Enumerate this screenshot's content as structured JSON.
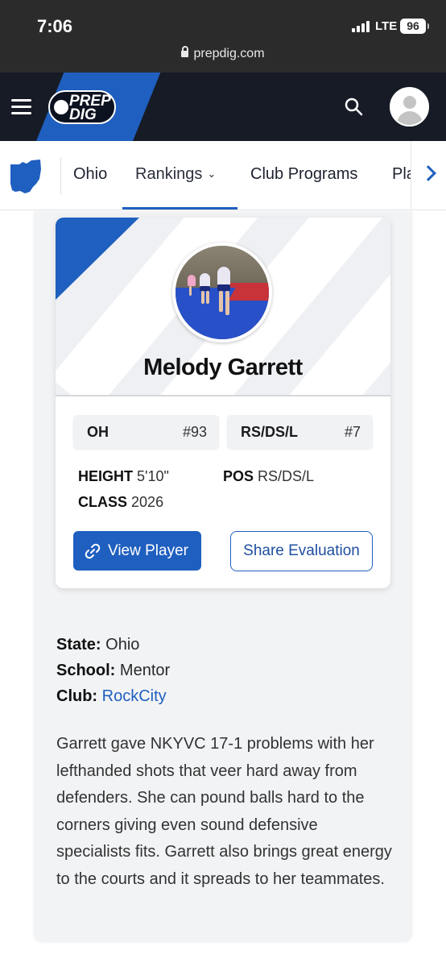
{
  "status_bar": {
    "time": "7:06",
    "network": "LTE",
    "battery": "96"
  },
  "browser": {
    "url": "prepdig.com"
  },
  "header": {
    "logo_line1": "PREP",
    "logo_line2": "DIG"
  },
  "nav": {
    "state": "Ohio",
    "items": [
      {
        "label": "Ohio"
      },
      {
        "label": "Rankings"
      },
      {
        "label": "Club Programs"
      },
      {
        "label": "Pla"
      }
    ],
    "active_color": "#1f5fbf"
  },
  "player": {
    "name": "Melody Garrett",
    "positions": [
      {
        "label": "OH",
        "rank": "#93"
      },
      {
        "label": "RS/DS/L",
        "rank": "#7"
      }
    ],
    "height_label": "HEIGHT",
    "height": "5'10\"",
    "pos_label": "POS",
    "pos": "RS/DS/L",
    "class_label": "CLASS",
    "class": "2026"
  },
  "actions": {
    "view_player": "View Player",
    "share_evaluation": "Share Evaluation"
  },
  "details": {
    "state_label": "State:",
    "state": "Ohio",
    "school_label": "School:",
    "school": "Mentor",
    "club_label": "Club:",
    "club": "RockCity"
  },
  "evaluation": "Garrett gave NKYVC 17-1 problems with her lefthanded shots that veer hard away from defenders. She can pound balls hard to the corners giving even sound defensive specialists fits. Garrett also brings great energy to the courts and it spreads to her teammates.",
  "colors": {
    "brand_blue": "#1f5fbf",
    "header_dark": "#161b26"
  }
}
